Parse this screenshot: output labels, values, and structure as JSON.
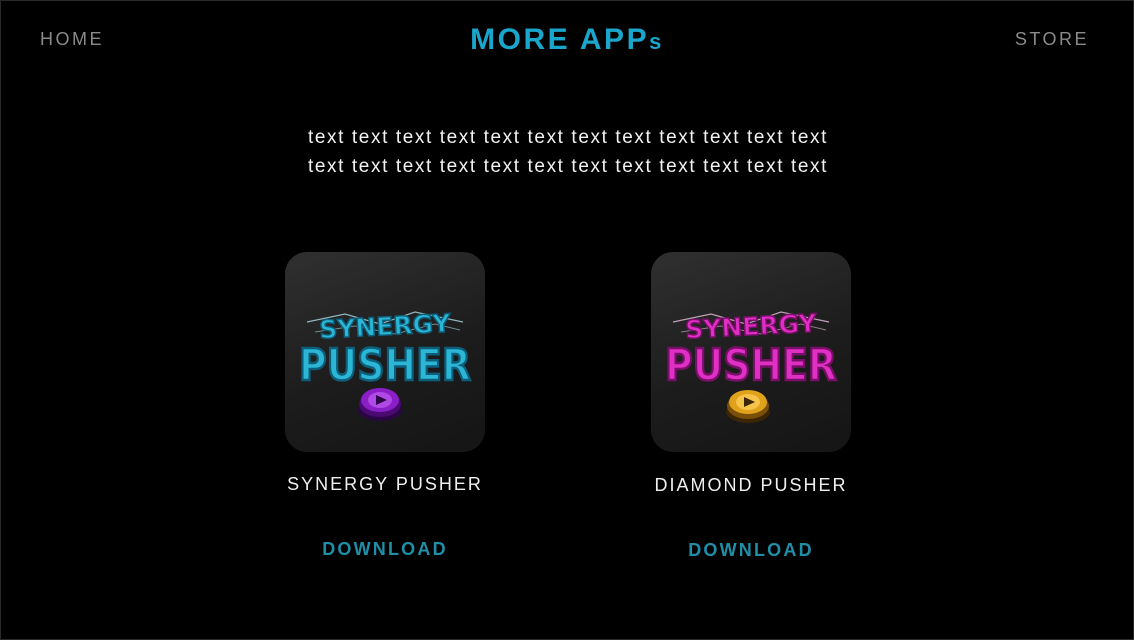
{
  "nav": {
    "home_label": "HOME",
    "store_label": "STORE"
  },
  "header": {
    "title_main": "MORE APP",
    "title_suffix": "s"
  },
  "description": {
    "line1": "text text text text text text text text text text text text",
    "line2": "text text text text text text text text text text text text"
  },
  "apps": [
    {
      "name": "SYNERGY PUSHER",
      "icon_top_text": "SYNERGY",
      "icon_main_text": "PUSHER",
      "icon_text_color": "#2bb6d6",
      "icon_text_shade": "#0c5e7a",
      "button_color": "#8a1fc7",
      "button_dark": "#4a0a72",
      "download_label": "DOWNLOAD",
      "icon": "app-logo-icon"
    },
    {
      "name": "DIAMOND PUSHER",
      "icon_top_text": "SYNERGY",
      "icon_main_text": "PUSHER",
      "icon_text_color": "#e02fc4",
      "icon_text_shade": "#7a0f6a",
      "button_color": "#e0a21a",
      "button_dark": "#7a5008",
      "download_label": "DOWNLOAD",
      "icon": "app-logo-icon"
    }
  ],
  "colors": {
    "title": "#1aa6cc",
    "download": "#1f8fa8",
    "nav": "#8a8a8a",
    "background": "#000000"
  }
}
